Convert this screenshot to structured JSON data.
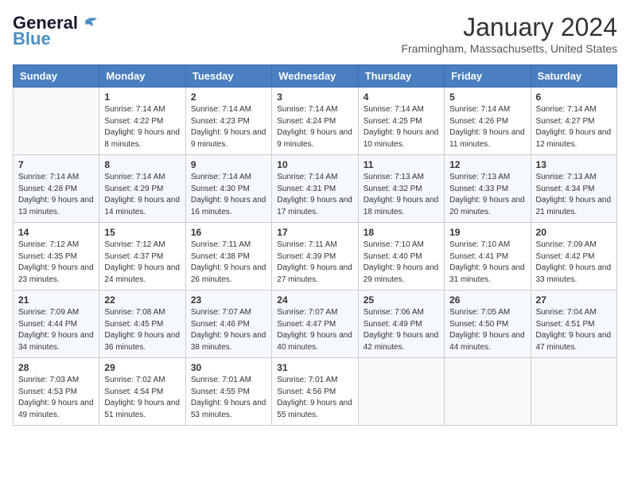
{
  "logo": {
    "part1": "General",
    "part2": "Blue"
  },
  "title": "January 2024",
  "location": "Framingham, Massachusetts, United States",
  "days_of_week": [
    "Sunday",
    "Monday",
    "Tuesday",
    "Wednesday",
    "Thursday",
    "Friday",
    "Saturday"
  ],
  "weeks": [
    [
      {
        "num": "",
        "sunrise": "",
        "sunset": "",
        "daylight": ""
      },
      {
        "num": "1",
        "sunrise": "Sunrise: 7:14 AM",
        "sunset": "Sunset: 4:22 PM",
        "daylight": "Daylight: 9 hours and 8 minutes."
      },
      {
        "num": "2",
        "sunrise": "Sunrise: 7:14 AM",
        "sunset": "Sunset: 4:23 PM",
        "daylight": "Daylight: 9 hours and 9 minutes."
      },
      {
        "num": "3",
        "sunrise": "Sunrise: 7:14 AM",
        "sunset": "Sunset: 4:24 PM",
        "daylight": "Daylight: 9 hours and 9 minutes."
      },
      {
        "num": "4",
        "sunrise": "Sunrise: 7:14 AM",
        "sunset": "Sunset: 4:25 PM",
        "daylight": "Daylight: 9 hours and 10 minutes."
      },
      {
        "num": "5",
        "sunrise": "Sunrise: 7:14 AM",
        "sunset": "Sunset: 4:26 PM",
        "daylight": "Daylight: 9 hours and 11 minutes."
      },
      {
        "num": "6",
        "sunrise": "Sunrise: 7:14 AM",
        "sunset": "Sunset: 4:27 PM",
        "daylight": "Daylight: 9 hours and 12 minutes."
      }
    ],
    [
      {
        "num": "7",
        "sunrise": "Sunrise: 7:14 AM",
        "sunset": "Sunset: 4:28 PM",
        "daylight": "Daylight: 9 hours and 13 minutes."
      },
      {
        "num": "8",
        "sunrise": "Sunrise: 7:14 AM",
        "sunset": "Sunset: 4:29 PM",
        "daylight": "Daylight: 9 hours and 14 minutes."
      },
      {
        "num": "9",
        "sunrise": "Sunrise: 7:14 AM",
        "sunset": "Sunset: 4:30 PM",
        "daylight": "Daylight: 9 hours and 16 minutes."
      },
      {
        "num": "10",
        "sunrise": "Sunrise: 7:14 AM",
        "sunset": "Sunset: 4:31 PM",
        "daylight": "Daylight: 9 hours and 17 minutes."
      },
      {
        "num": "11",
        "sunrise": "Sunrise: 7:13 AM",
        "sunset": "Sunset: 4:32 PM",
        "daylight": "Daylight: 9 hours and 18 minutes."
      },
      {
        "num": "12",
        "sunrise": "Sunrise: 7:13 AM",
        "sunset": "Sunset: 4:33 PM",
        "daylight": "Daylight: 9 hours and 20 minutes."
      },
      {
        "num": "13",
        "sunrise": "Sunrise: 7:13 AM",
        "sunset": "Sunset: 4:34 PM",
        "daylight": "Daylight: 9 hours and 21 minutes."
      }
    ],
    [
      {
        "num": "14",
        "sunrise": "Sunrise: 7:12 AM",
        "sunset": "Sunset: 4:35 PM",
        "daylight": "Daylight: 9 hours and 23 minutes."
      },
      {
        "num": "15",
        "sunrise": "Sunrise: 7:12 AM",
        "sunset": "Sunset: 4:37 PM",
        "daylight": "Daylight: 9 hours and 24 minutes."
      },
      {
        "num": "16",
        "sunrise": "Sunrise: 7:11 AM",
        "sunset": "Sunset: 4:38 PM",
        "daylight": "Daylight: 9 hours and 26 minutes."
      },
      {
        "num": "17",
        "sunrise": "Sunrise: 7:11 AM",
        "sunset": "Sunset: 4:39 PM",
        "daylight": "Daylight: 9 hours and 27 minutes."
      },
      {
        "num": "18",
        "sunrise": "Sunrise: 7:10 AM",
        "sunset": "Sunset: 4:40 PM",
        "daylight": "Daylight: 9 hours and 29 minutes."
      },
      {
        "num": "19",
        "sunrise": "Sunrise: 7:10 AM",
        "sunset": "Sunset: 4:41 PM",
        "daylight": "Daylight: 9 hours and 31 minutes."
      },
      {
        "num": "20",
        "sunrise": "Sunrise: 7:09 AM",
        "sunset": "Sunset: 4:42 PM",
        "daylight": "Daylight: 9 hours and 33 minutes."
      }
    ],
    [
      {
        "num": "21",
        "sunrise": "Sunrise: 7:09 AM",
        "sunset": "Sunset: 4:44 PM",
        "daylight": "Daylight: 9 hours and 34 minutes."
      },
      {
        "num": "22",
        "sunrise": "Sunrise: 7:08 AM",
        "sunset": "Sunset: 4:45 PM",
        "daylight": "Daylight: 9 hours and 36 minutes."
      },
      {
        "num": "23",
        "sunrise": "Sunrise: 7:07 AM",
        "sunset": "Sunset: 4:46 PM",
        "daylight": "Daylight: 9 hours and 38 minutes."
      },
      {
        "num": "24",
        "sunrise": "Sunrise: 7:07 AM",
        "sunset": "Sunset: 4:47 PM",
        "daylight": "Daylight: 9 hours and 40 minutes."
      },
      {
        "num": "25",
        "sunrise": "Sunrise: 7:06 AM",
        "sunset": "Sunset: 4:49 PM",
        "daylight": "Daylight: 9 hours and 42 minutes."
      },
      {
        "num": "26",
        "sunrise": "Sunrise: 7:05 AM",
        "sunset": "Sunset: 4:50 PM",
        "daylight": "Daylight: 9 hours and 44 minutes."
      },
      {
        "num": "27",
        "sunrise": "Sunrise: 7:04 AM",
        "sunset": "Sunset: 4:51 PM",
        "daylight": "Daylight: 9 hours and 47 minutes."
      }
    ],
    [
      {
        "num": "28",
        "sunrise": "Sunrise: 7:03 AM",
        "sunset": "Sunset: 4:53 PM",
        "daylight": "Daylight: 9 hours and 49 minutes."
      },
      {
        "num": "29",
        "sunrise": "Sunrise: 7:02 AM",
        "sunset": "Sunset: 4:54 PM",
        "daylight": "Daylight: 9 hours and 51 minutes."
      },
      {
        "num": "30",
        "sunrise": "Sunrise: 7:01 AM",
        "sunset": "Sunset: 4:55 PM",
        "daylight": "Daylight: 9 hours and 53 minutes."
      },
      {
        "num": "31",
        "sunrise": "Sunrise: 7:01 AM",
        "sunset": "Sunset: 4:56 PM",
        "daylight": "Daylight: 9 hours and 55 minutes."
      },
      {
        "num": "",
        "sunrise": "",
        "sunset": "",
        "daylight": ""
      },
      {
        "num": "",
        "sunrise": "",
        "sunset": "",
        "daylight": ""
      },
      {
        "num": "",
        "sunrise": "",
        "sunset": "",
        "daylight": ""
      }
    ]
  ]
}
